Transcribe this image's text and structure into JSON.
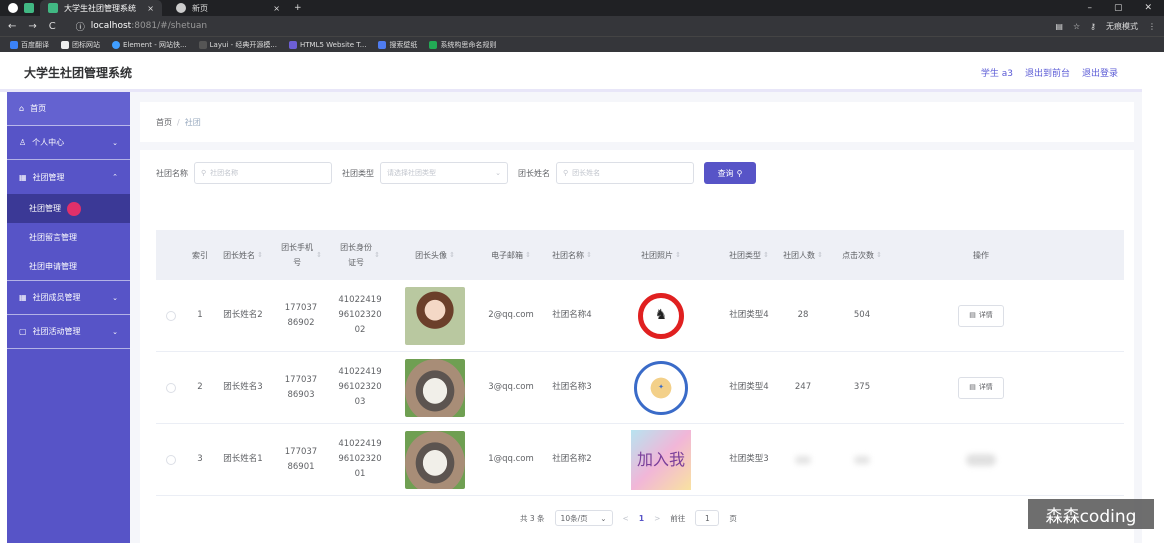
{
  "browser": {
    "tabs": [
      {
        "label": "大学生社团管理系统",
        "close": "×"
      },
      {
        "label": "新页",
        "close": "×"
      }
    ],
    "new_tab": "+",
    "window_controls": [
      "–",
      "▢",
      "✕"
    ],
    "url_host": "localhost",
    "url_path": ":8081/#/shetuan",
    "incognito": "无痕模式",
    "bookmarks": [
      "百度翻译",
      "团标网站",
      "Element - 网站快...",
      "Layui - 经典开源模...",
      "HTML5 Website T...",
      "搜索壁纸",
      "系统构思命名规则"
    ]
  },
  "header": {
    "title": "大学生社团管理系统",
    "links": [
      "学生 a3",
      "退出到前台",
      "退出登录"
    ]
  },
  "sidebar": {
    "items": [
      {
        "label": "首页",
        "icon": "home-icon"
      },
      {
        "label": "个人中心",
        "icon": "user-icon",
        "chevron": "⌄"
      },
      {
        "label": "社团管理",
        "icon": "grid-icon",
        "chevron": "⌃"
      },
      {
        "label": "社团成员管理",
        "icon": "grid-icon",
        "chevron": "⌄"
      },
      {
        "label": "社团活动管理",
        "icon": "doc-icon",
        "chevron": "⌄"
      }
    ],
    "subitems": [
      "社团管理",
      "社团留言管理",
      "社团申请管理"
    ]
  },
  "breadcrumb": {
    "home": "首页",
    "sep": "/",
    "current": "社团"
  },
  "search": {
    "name_label": "社团名称",
    "name_placeholder": "社团名称",
    "type_label": "社团类型",
    "type_placeholder": "请选择社团类型",
    "leader_label": "团长姓名",
    "leader_placeholder": "团长姓名",
    "button": "查询"
  },
  "table": {
    "headers": [
      "索引",
      "团长姓名",
      "团长手机号",
      "团长身份证号",
      "团长头像",
      "电子邮箱",
      "社团名称",
      "社团照片",
      "社团类型",
      "社团人数",
      "点击次数",
      "操作"
    ],
    "sort_glyph": "⇕",
    "rows": [
      {
        "index": "1",
        "leader": "团长姓名2",
        "phone": "17703786902",
        "idcard": "410224199610232002",
        "email": "2@qq.com",
        "club": "社团名称4",
        "type": "社团类型4",
        "members": "28",
        "clicks": "504",
        "action": "详情"
      },
      {
        "index": "2",
        "leader": "团长姓名3",
        "phone": "17703786903",
        "idcard": "410224199610232003",
        "email": "3@qq.com",
        "club": "社团名称3",
        "type": "社团类型4",
        "members": "247",
        "clicks": "375",
        "action": "详情"
      },
      {
        "index": "3",
        "leader": "团长姓名1",
        "phone": "17703786901",
        "idcard": "410224199610232001",
        "email": "1@qq.com",
        "club": "社团名称2",
        "type": "社团类型3",
        "members": "",
        "clicks": "",
        "action": ""
      }
    ]
  },
  "pagination": {
    "total": "共 3 条",
    "page_size": "10条/页",
    "prev": "<",
    "current": "1",
    "next": ">",
    "goto": "前往",
    "page": "1",
    "page_suffix": "页"
  },
  "watermark": "森森coding",
  "photo_text": {
    "join": "加入我"
  }
}
